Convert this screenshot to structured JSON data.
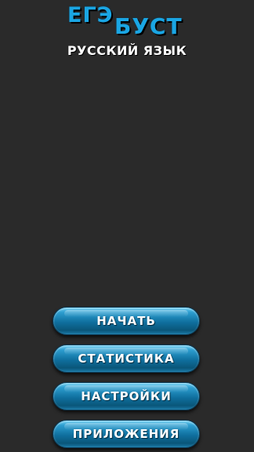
{
  "app": {
    "logo_line1": "ЕГЭ",
    "logo_line2": "БУСТ",
    "subtitle": "РУССКИЙ ЯЗЫК"
  },
  "menu": {
    "items": [
      {
        "label": "НАЧАТЬ"
      },
      {
        "label": "СТАТИСТИКА"
      },
      {
        "label": "НАСТРОЙКИ"
      },
      {
        "label": "ПРИЛОЖЕНИЯ"
      }
    ]
  },
  "colors": {
    "background": "#2a2a2a",
    "logo_accent": "#1aa6e4",
    "button_primary": "#0f6f9e",
    "text": "#ffffff"
  }
}
